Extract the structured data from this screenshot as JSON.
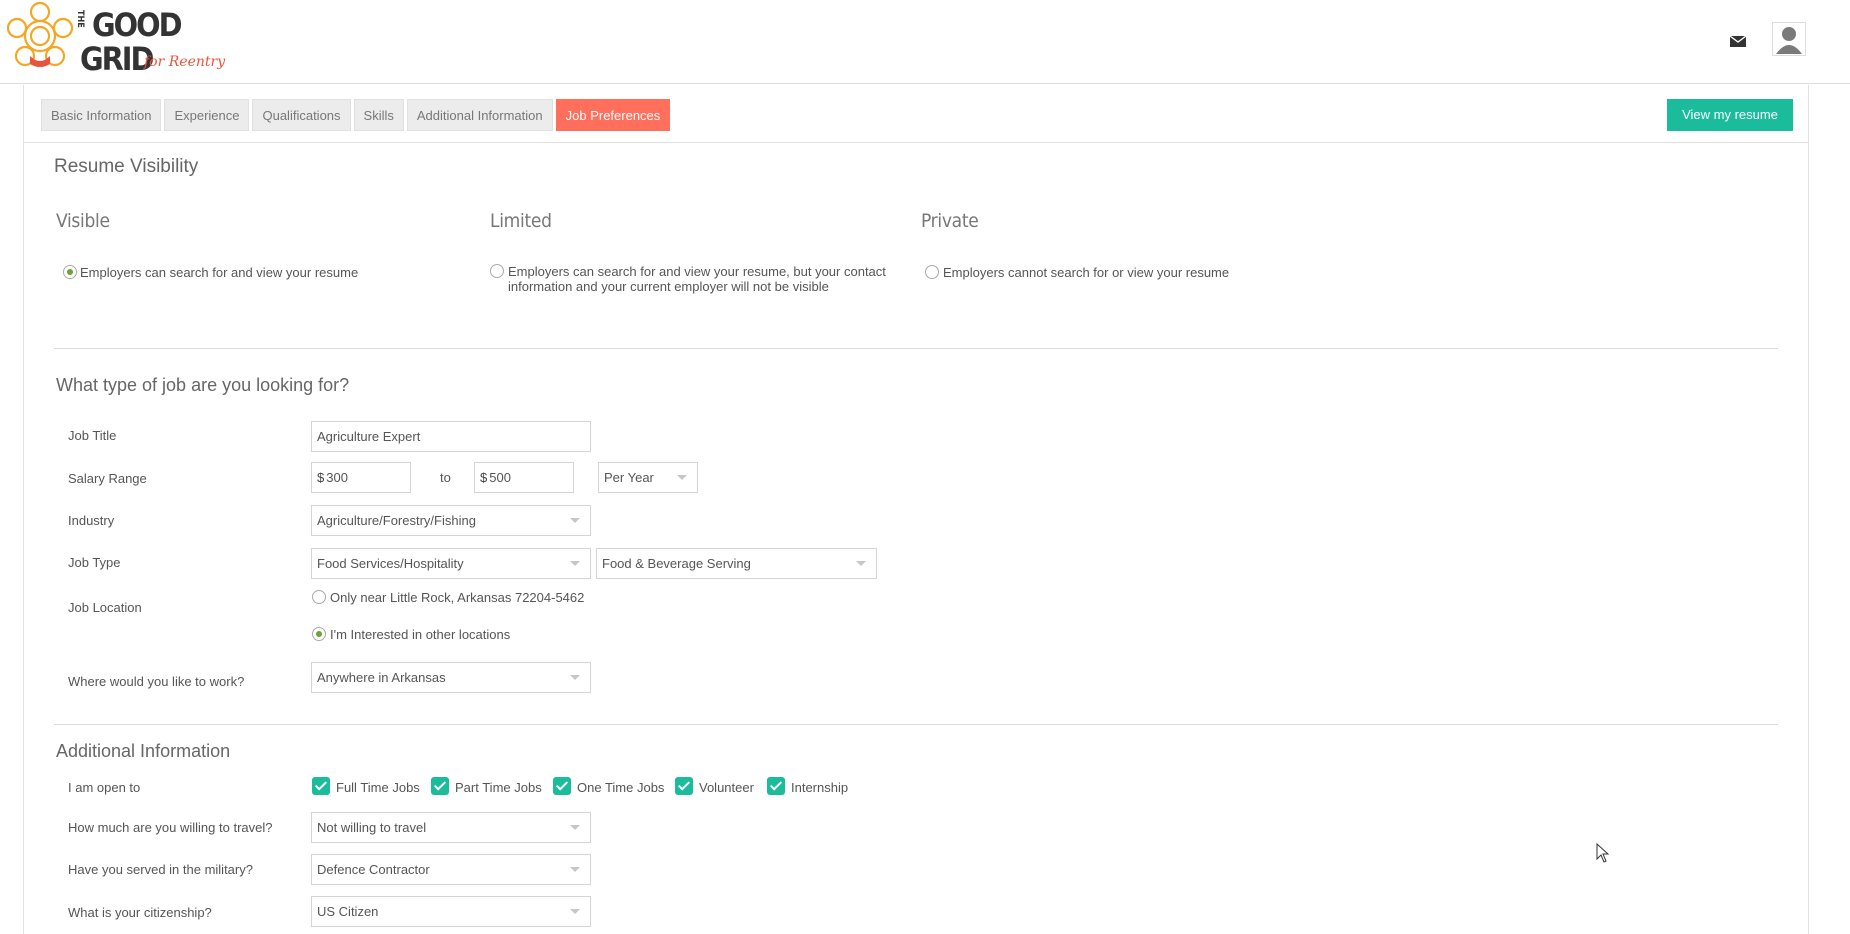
{
  "header": {
    "logo": {
      "line1": "THE",
      "word1": "GOOD",
      "word2": "GRID",
      "tagline": "for Reentry"
    },
    "mail_icon": "envelope-icon",
    "user_icon": "user-avatar-icon"
  },
  "tabs": [
    {
      "label": "Basic Information",
      "active": false
    },
    {
      "label": "Experience",
      "active": false
    },
    {
      "label": "Qualifications",
      "active": false
    },
    {
      "label": "Skills",
      "active": false
    },
    {
      "label": "Additional Information",
      "active": false
    },
    {
      "label": "Job Preferences",
      "active": true
    }
  ],
  "view_resume_label": "View my resume",
  "visibility": {
    "title": "Resume Visibility",
    "options": [
      {
        "heading": "Visible",
        "line1": "Employers can search for and view your resume",
        "line2": "",
        "selected": true
      },
      {
        "heading": "Limited",
        "line1": "Employers can search for and view your resume, but your contact",
        "line2": "information and your current employer will not be visible",
        "selected": false
      },
      {
        "heading": "Private",
        "line1": "Employers cannot search for or view your resume",
        "line2": "",
        "selected": false
      }
    ]
  },
  "job": {
    "title": "What type of job are you looking for?",
    "job_title_label": "Job Title",
    "job_title_value": "Agriculture Expert",
    "salary_label": "Salary Range",
    "salary_currency": "$",
    "salary_min": "300",
    "salary_to": "to",
    "salary_max": "500",
    "salary_period": "Per Year",
    "industry_label": "Industry",
    "industry_value": "Agriculture/Forestry/Fishing",
    "job_type_label": "Job Type",
    "job_type_value": "Food Services/Hospitality",
    "job_subtype_value": "Food & Beverage Serving",
    "location_label": "Job Location",
    "location_option1": "Only near Little Rock, Arkansas 72204-5462",
    "location_option2": "I'm Interested in other locations",
    "location_selected": 2,
    "where_label": "Where would you like to work?",
    "where_value": "Anywhere in Arkansas"
  },
  "additional": {
    "title": "Additional Information",
    "open_to_label": "I am open to",
    "open_to": [
      {
        "label": "Full Time Jobs",
        "checked": true
      },
      {
        "label": "Part Time Jobs",
        "checked": true
      },
      {
        "label": "One Time Jobs",
        "checked": true
      },
      {
        "label": "Volunteer",
        "checked": true
      },
      {
        "label": "Internship",
        "checked": true
      }
    ],
    "travel_label": "How much are you willing to travel?",
    "travel_value": "Not willing to travel",
    "military_label": "Have you served in the military?",
    "military_value": "Defence Contractor",
    "citizenship_label": "What is your citizenship?",
    "citizenship_value": "US Citizen"
  },
  "colors": {
    "accent_tab": "#ff6f5c",
    "teal": "#1bbc9b",
    "radio_green": "#6aa52f"
  }
}
